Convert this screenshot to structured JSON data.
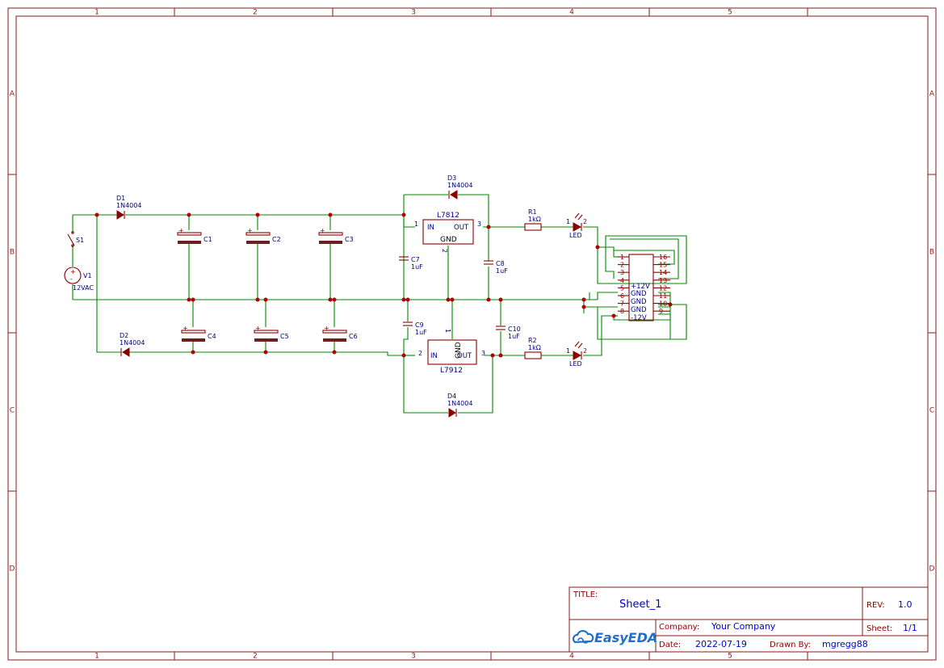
{
  "frame": {
    "columns": [
      "1",
      "2",
      "3",
      "4",
      "5"
    ],
    "rows": [
      "A",
      "B",
      "C",
      "D"
    ]
  },
  "components": {
    "S1": {
      "ref": "S1"
    },
    "V1": {
      "ref": "V1",
      "value": "12VAC"
    },
    "D1": {
      "ref": "D1",
      "value": "1N4004"
    },
    "D2": {
      "ref": "D2",
      "value": "1N4004"
    },
    "D3": {
      "ref": "D3",
      "value": "1N4004"
    },
    "D4": {
      "ref": "D4",
      "value": "1N4004"
    },
    "C1": {
      "ref": "C1"
    },
    "C2": {
      "ref": "C2"
    },
    "C3": {
      "ref": "C3"
    },
    "C4": {
      "ref": "C4"
    },
    "C5": {
      "ref": "C5"
    },
    "C6": {
      "ref": "C6"
    },
    "C7": {
      "ref": "C7",
      "value": "1uF"
    },
    "C8": {
      "ref": "C8",
      "value": "1uF"
    },
    "C9": {
      "ref": "C9",
      "value": "1uF"
    },
    "C10": {
      "ref": "C10",
      "value": "1uF"
    },
    "R1": {
      "ref": "R1",
      "value": "1kΩ"
    },
    "R2": {
      "ref": "R2",
      "value": "1kΩ"
    },
    "LED1": {
      "ref": "LED"
    },
    "LED2": {
      "ref": "LED"
    },
    "U1": {
      "name": "L7812",
      "pin_in": "IN",
      "pin_out": "OUT",
      "pin_gnd": "GND",
      "n1": "1",
      "n2": "2",
      "n3": "3"
    },
    "U2": {
      "name": "L7912",
      "pin_in": "IN",
      "pin_out": "OUT",
      "pin_gnd": "GND",
      "n1": "1",
      "n2": "2",
      "n3": "3"
    },
    "header": {
      "left_pins": [
        "1",
        "2",
        "3",
        "4",
        "5",
        "6",
        "7",
        "8"
      ],
      "right_pins": [
        "16",
        "15",
        "14",
        "13",
        "12",
        "11",
        "10",
        "9"
      ],
      "labels": [
        "+12V",
        "GND",
        "GND",
        "GND",
        "-12V"
      ]
    },
    "plus": "+",
    "minus": "-",
    "led_pin1": "1",
    "led_pin2": "2"
  },
  "title_block": {
    "title_label": "TITLE:",
    "title": "Sheet_1",
    "rev_label": "REV:",
    "rev": "1.0",
    "company_label": "Company:",
    "company": "Your Company",
    "sheet_label": "Sheet:",
    "sheet": "1/1",
    "date_label": "Date:",
    "date": "2022-07-19",
    "drawn_label": "Drawn By:",
    "drawn_by": "mgregg88",
    "logo": "EasyEDA",
    "logo_icon": "cloud-icon"
  },
  "colors": {
    "wire": "#008800",
    "component": "#8b0000",
    "label": "#000080",
    "frame": "#8b1a1a",
    "title_value": "#0000cc"
  }
}
